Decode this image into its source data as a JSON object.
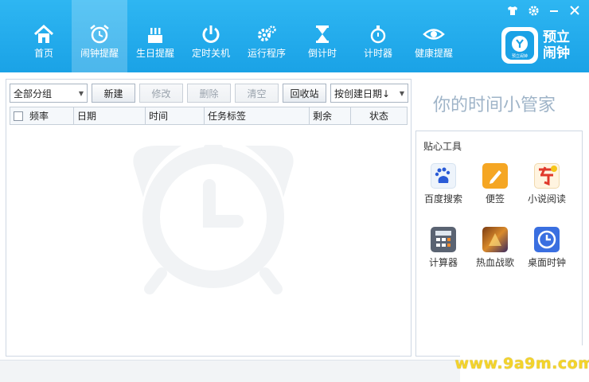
{
  "app": {
    "brand_line1": "预立",
    "brand_line2": "闹钟",
    "brand_logo_text": "预立闹钟"
  },
  "window_controls": [
    "shirt-icon",
    "gear-icon",
    "minimize-icon",
    "close-icon"
  ],
  "nav": {
    "items": [
      {
        "label": "首页",
        "icon": "home-icon",
        "active": false
      },
      {
        "label": "闹钟提醒",
        "icon": "alarm-icon",
        "active": true
      },
      {
        "label": "生日提醒",
        "icon": "cake-icon",
        "active": false
      },
      {
        "label": "定时关机",
        "icon": "power-icon",
        "active": false
      },
      {
        "label": "运行程序",
        "icon": "gears-icon",
        "active": false
      },
      {
        "label": "倒计时",
        "icon": "hourglass-icon",
        "active": false
      },
      {
        "label": "计时器",
        "icon": "stopwatch-icon",
        "active": false
      },
      {
        "label": "健康提醒",
        "icon": "eye-icon",
        "active": false
      }
    ]
  },
  "toolbar": {
    "group_select": "全部分组",
    "new": "新建",
    "edit": "修改",
    "delete": "删除",
    "clear": "清空",
    "recycle": "回收站",
    "sort_select": "按创建日期↓"
  },
  "table": {
    "columns": [
      "频率",
      "日期",
      "时间",
      "任务标签",
      "剩余",
      "状态"
    ]
  },
  "slogan": "你的时间小管家",
  "tools": {
    "title": "贴心工具",
    "items": [
      {
        "label": "百度搜索",
        "icon": "baidu-icon"
      },
      {
        "label": "便签",
        "icon": "notepad-icon"
      },
      {
        "label": "小说阅读",
        "icon": "novel-icon"
      },
      {
        "label": "计算器",
        "icon": "calculator-icon"
      },
      {
        "label": "热血战歌",
        "icon": "game-icon"
      },
      {
        "label": "桌面时钟",
        "icon": "clock-icon"
      }
    ]
  },
  "site_mark": "www.9a9m.com",
  "colors": {
    "accent": "#1aa2e6",
    "slogan": "#9fb4c8"
  }
}
